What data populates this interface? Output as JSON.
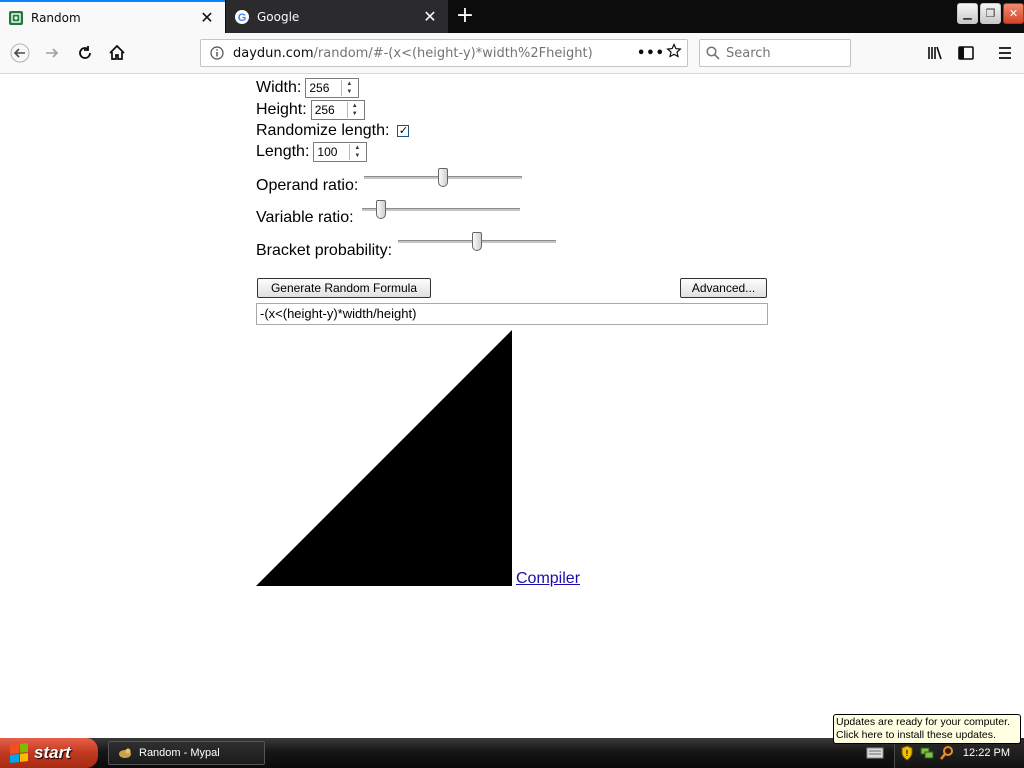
{
  "browser": {
    "tabs": [
      {
        "title": "Random",
        "active": true
      },
      {
        "title": "Google",
        "active": false
      }
    ],
    "url_host": "daydun.com",
    "url_path": "/random/#-(x<(height-y)*width%2Fheight)",
    "search_placeholder": "Search"
  },
  "form": {
    "width_label": "Width:",
    "width_value": "256",
    "height_label": "Height:",
    "height_value": "256",
    "randomize_label": "Randomize length:",
    "randomize_checked": true,
    "length_label": "Length:",
    "length_value": "100",
    "operand_label": "Operand ratio:",
    "operand_value": 0.5,
    "variable_label": "Variable ratio:",
    "variable_value": 0.12,
    "bracket_label": "Bracket probability:",
    "bracket_value": 0.5,
    "generate_label": "Generate Random Formula",
    "advanced_label": "Advanced...",
    "formula_value": "-(x<(height-y)*width/height)",
    "compiler_link": "Compiler"
  },
  "taskbar": {
    "start_label": "start",
    "task_item": "Random - Mypal",
    "clock": "12:22 PM",
    "balloon_line1": "Updates are ready for your computer.",
    "balloon_line2": "Click here to install these updates."
  },
  "colors": {
    "accent": "#0a84ff",
    "link": "#1a0dab",
    "start_red": "#c0391f"
  }
}
